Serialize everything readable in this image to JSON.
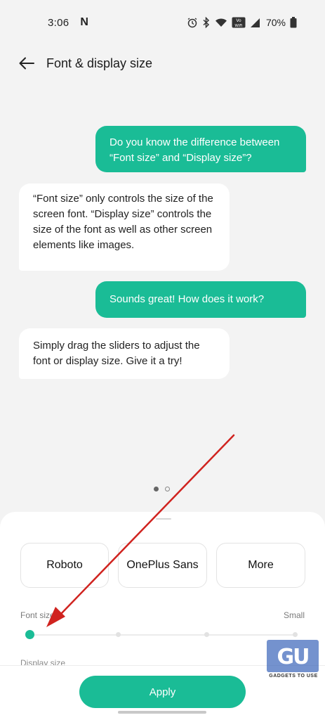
{
  "status_bar": {
    "time": "3:06",
    "notification_icon": "N",
    "battery": "70%",
    "icons": [
      "alarm-icon",
      "bluetooth-icon",
      "wifi-icon",
      "vowifi-icon",
      "signal-icon",
      "battery-icon"
    ]
  },
  "header": {
    "title": "Font & display size",
    "back_icon": "back-arrow-icon"
  },
  "messages": [
    {
      "type": "sent",
      "text": "Do you know the difference between “Font size” and “Display size”?"
    },
    {
      "type": "received",
      "text": "“Font size” only controls the size of the screen font. “Display size” controls the size of the font as well as other screen elements like images."
    },
    {
      "type": "sent",
      "text": "Sounds great! How does it work?"
    },
    {
      "type": "received",
      "text": "Simply drag the sliders to adjust the font or display size. Give it a try!"
    }
  ],
  "pager": {
    "pages": 2,
    "current": 1
  },
  "font_options": [
    "Roboto",
    "OnePlus Sans",
    "More"
  ],
  "font_size": {
    "label": "Font size",
    "min_label": "Small",
    "steps": 4,
    "value_step": 0
  },
  "display_size": {
    "label": "Display size"
  },
  "apply_label": "Apply",
  "watermark": {
    "logo": "GU",
    "text": "GADGETS TO USE"
  },
  "colors": {
    "accent": "#1abc96",
    "background": "#f3f3f3",
    "annotation_arrow": "#d0231f"
  }
}
